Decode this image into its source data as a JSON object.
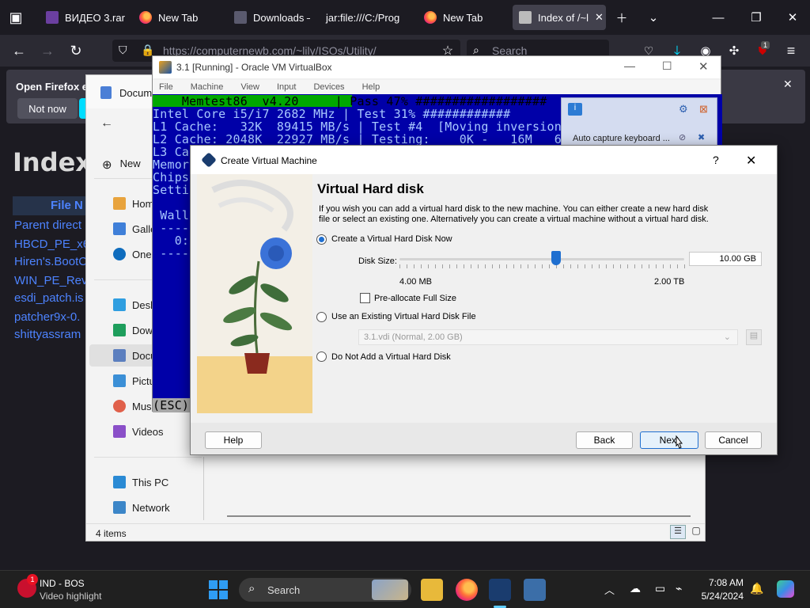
{
  "browser": {
    "tabs": [
      {
        "label": "ВИДЕО 3.rar"
      },
      {
        "label": "New Tab"
      },
      {
        "label": "Downloads – "
      },
      {
        "label": "jar:file:///C:/Prog"
      },
      {
        "label": "New Tab"
      },
      {
        "label": "Index of /~l"
      }
    ],
    "url": "https://computernewb.com/~lily/ISOs/Utility/",
    "search_placeholder": "Search",
    "ext_badge": "1"
  },
  "notification": {
    "text": "Open Firefox ev",
    "not_now": "Not now"
  },
  "page": {
    "title": "Index",
    "file_header": "File N",
    "files": [
      "Parent direct",
      "HBCD_PE_x6",
      "Hiren's.BootC",
      "WIN_PE_Rev",
      "esdi_patch.is",
      "patcher9x-0.",
      "shittyassram"
    ]
  },
  "explorer": {
    "tab_label": "Docum",
    "new_label": "New",
    "nav": [
      "Home",
      "Galler",
      "OneD",
      "Deskt",
      "Down",
      "Docu",
      "Pictu",
      "Musi",
      "Videos",
      "This PC",
      "Network"
    ],
    "status": "4 items"
  },
  "vm": {
    "title": "3.1 [Running] - Oracle VM VirtualBox",
    "menu": [
      "File",
      "Machine",
      "View",
      "Input",
      "Devices",
      "Help"
    ],
    "screen_lines": [
      "    Memtest86  v4.20     | Pass 47% ##################",
      "Intel Core i5/i7 2682 MHz | Test 31% ############",
      "L1 Cache:   32K  89415 MB/s | Test #4  [Moving inversions",
      "L2 Cache: 2048K  22927 MB/s | Testing:    0K -   16M   62",
      "L3 Cac",
      "Memor",
      "Chips",
      "Setti",
      "",
      " Wall",
      " ----",
      "   0:0",
      " ----"
    ],
    "esc_label": "(ESC)E",
    "auto_capture": "Auto capture keyboard ..."
  },
  "dialog": {
    "title": "Create Virtual Machine",
    "help_q": "?",
    "heading": "Virtual Hard disk",
    "description": "If you wish you can add a virtual hard disk to the new machine. You can either create a new hard disk file or select an existing one. Alternatively you can create a virtual machine without a virtual hard disk.",
    "opt_create": "Create a Virtual Hard Disk Now",
    "disk_size_label": "Disk Size:",
    "disk_size_value": "10.00 GB",
    "slider_min": "4.00 MB",
    "slider_max": "2.00 TB",
    "slider_level": 0.55,
    "preallocate": "Pre-allocate Full Size",
    "opt_existing": "Use an Existing Virtual Hard Disk File",
    "existing_file": "3.1.vdi (Normal, 2.00 GB)",
    "opt_none": "Do Not Add a Virtual Hard Disk",
    "btn_help": "Help",
    "btn_back": "Back",
    "btn_next": "Next",
    "btn_cancel": "Cancel"
  },
  "taskbar": {
    "news_title": "IND - BOS",
    "news_sub": "Video highlight",
    "news_badge": "1",
    "search": "Search",
    "time": "7:08 AM",
    "date": "5/24/2024"
  }
}
